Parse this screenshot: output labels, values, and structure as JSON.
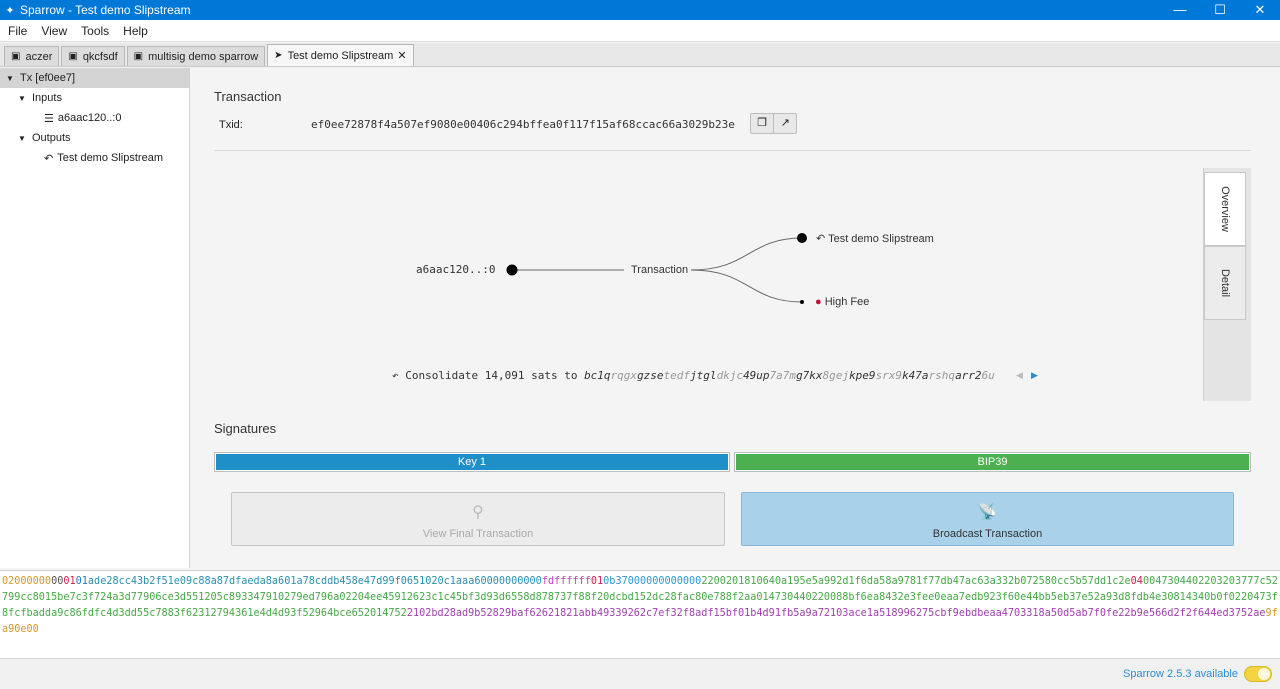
{
  "window": {
    "title": "Sparrow - Test demo Slipstream",
    "controls": [
      "—",
      "☐",
      "✕"
    ]
  },
  "menu": [
    "File",
    "View",
    "Tools",
    "Help"
  ],
  "tabs": [
    {
      "label": "aczer",
      "active": false
    },
    {
      "label": "qkcfsdf",
      "active": false
    },
    {
      "label": "multisig demo sparrow",
      "active": false
    },
    {
      "label": "Test demo Slipstream",
      "active": true
    }
  ],
  "tree": {
    "root": "Tx [ef0ee7]",
    "inputs_label": "Inputs",
    "input_item": "a6aac120..:0",
    "outputs_label": "Outputs",
    "output_item": "Test demo Slipstream"
  },
  "transaction": {
    "section_title": "Transaction",
    "txid_label": "Txid:",
    "txid": "ef0ee72878f4a507ef9080e00406c294bffea0f117f15af68ccac66a3029b23e"
  },
  "diagram": {
    "input_label": "a6aac120..:0",
    "center_label": "Transaction",
    "output_label": "Test demo Slipstream",
    "fee_label": "High Fee",
    "consolidate_prefix": "Consolidate 14,091 sats to ",
    "addr_parts": [
      [
        "bc1q",
        false
      ],
      [
        "rqgx",
        true
      ],
      [
        "gzse",
        false
      ],
      [
        "tedf",
        true
      ],
      [
        "jtgl",
        false
      ],
      [
        "dkjc",
        true
      ],
      [
        "49up",
        false
      ],
      [
        "7a7m",
        true
      ],
      [
        "g7kx",
        false
      ],
      [
        "8gej",
        true
      ],
      [
        "kpe9",
        false
      ],
      [
        "srx9",
        true
      ],
      [
        "k47a",
        false
      ],
      [
        "rshq",
        true
      ],
      [
        "arr2",
        false
      ],
      [
        "6u",
        true
      ]
    ]
  },
  "side_tabs": {
    "overview": "Overview",
    "detail": "Detail"
  },
  "signatures": {
    "section_title": "Signatures",
    "key1": "Key 1",
    "bip39": "BIP39",
    "key1_color": "#1f90c7",
    "bip39_color": "#4caf50"
  },
  "buttons": {
    "view_final": "View Final Transaction",
    "broadcast": "Broadcast Transaction"
  },
  "hex_segments": [
    [
      "02000000",
      "#d29a28"
    ],
    [
      "00",
      "#555"
    ],
    [
      "01",
      "#d02050"
    ],
    [
      "01",
      "#2a7bb8"
    ],
    [
      "ade28cc43b2f51e09c88a87dfaeda8a601a78cddb458e47d99f0651020c1aaa6",
      "#2a90b0"
    ],
    [
      "0000000000",
      "#2a90b0"
    ],
    [
      "fdffffff",
      "#c040c0"
    ],
    [
      "01",
      "#d02050"
    ],
    [
      "0b37000000000000",
      "#2a9bd0"
    ],
    [
      "2200201810640a195e5a992d1f6da58a9781f77db47ac63a332b072580cc5b57dd1c2e",
      "#48a848"
    ],
    [
      "04",
      "#d02050"
    ],
    [
      "0047304402203203777c52799cc8015be7c3f724a3d77906ce3d551205c893347910279ed796a02204ee45912623c1c45bf3d93d6558d878737f88f20dcbd152dc28fac80e788f2aa014730440220088bf6ea8432e3fee0eaa7edb923f60e44bb5eb37e52a93d8fdb4e30814340b0f0220473f8fcfbadda9c86fdfc4d3dd55c7883f62312794361e4d4d93f52964bce652014752",
      "#48a848"
    ],
    [
      "2102bd28ad9b52829baf62621821abb49339262c7ef32f8adf15bf01b4d91fb5a9a72103ace1a518996275cbf9ebdbeaa4703318a50d5ab7f0fe22b9e566d2f2f644ed3752ae",
      "#a040b0"
    ],
    [
      "9fa90e00",
      "#d29a28"
    ]
  ],
  "status": {
    "update": "Sparrow 2.5.3 available"
  }
}
